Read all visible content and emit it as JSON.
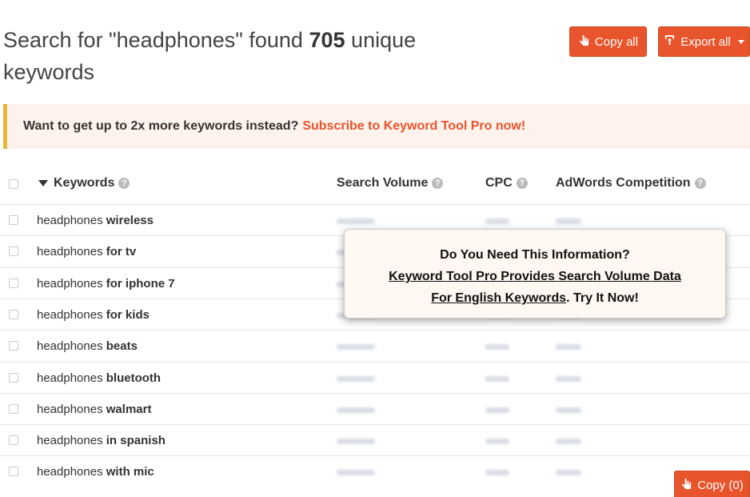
{
  "header": {
    "title_prefix": "Search for \"headphones\" found",
    "count": "705",
    "title_suffix_1": "unique",
    "title_suffix_2": "keywords"
  },
  "buttons": {
    "copy_all": "Copy all",
    "export_all": "Export all",
    "copy_count": "Copy (0)"
  },
  "promo": {
    "text": "Want to get up to 2x more keywords instead?",
    "link": "Subscribe to Keyword Tool Pro now!"
  },
  "table": {
    "columns": {
      "keywords": "Keywords",
      "search_volume": "Search Volume",
      "cpc": "CPC",
      "competition": "AdWords Competition"
    },
    "rows": [
      {
        "base": "headphones",
        "suffix": "wireless"
      },
      {
        "base": "headphones",
        "suffix": "for tv"
      },
      {
        "base": "headphones",
        "suffix": "for iphone 7"
      },
      {
        "base": "headphones",
        "suffix": "for kids"
      },
      {
        "base": "headphones",
        "suffix": "beats"
      },
      {
        "base": "headphones",
        "suffix": "bluetooth"
      },
      {
        "base": "headphones",
        "suffix": "walmart"
      },
      {
        "base": "headphones",
        "suffix": "in spanish"
      },
      {
        "base": "headphones",
        "suffix": "with mic"
      }
    ]
  },
  "overlay": {
    "heading": "Do You Need This Information?",
    "line1": "Keyword Tool Pro Provides Search Volume Data",
    "line2_link": "For English Keywords",
    "line2_tail": ". Try It Now!"
  },
  "colors": {
    "accent": "#e8542c",
    "promo_bg": "#fdf3ec",
    "promo_border": "#e8b73a"
  },
  "icons": {
    "copy": "hand-pointer-icon",
    "export": "export-icon",
    "help": "help-circle-icon",
    "sort": "sort-down-icon"
  }
}
